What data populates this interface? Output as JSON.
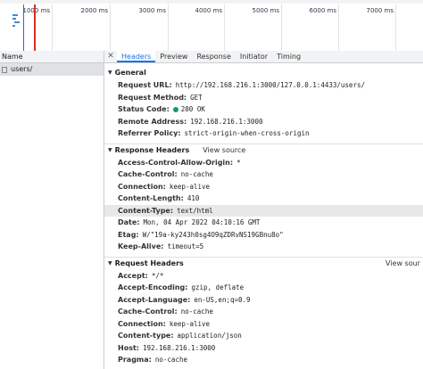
{
  "overview": {
    "ticks": [
      "1000 ms",
      "2000 ms",
      "3000 ms",
      "4000 ms",
      "5000 ms",
      "6000 ms",
      "7000 ms"
    ]
  },
  "left": {
    "column_header": "Name",
    "request_name": "users/"
  },
  "tabs": [
    "Headers",
    "Preview",
    "Response",
    "Initiator",
    "Timing"
  ],
  "general": {
    "title": "General",
    "rows": [
      {
        "key": "Request URL:",
        "value": "http://192.168.216.1:3000/127.0.0.1:4433/users/"
      },
      {
        "key": "Request Method:",
        "value": "GET"
      },
      {
        "key": "Status Code:",
        "value": "200 OK"
      },
      {
        "key": "Remote Address:",
        "value": "192.168.216.1:3000"
      },
      {
        "key": "Referrer Policy:",
        "value": "strict-origin-when-cross-origin"
      }
    ]
  },
  "response_headers": {
    "title": "Response Headers",
    "view_source": "View source",
    "rows": [
      {
        "key": "Access-Control-Allow-Origin:",
        "value": "*"
      },
      {
        "key": "Cache-Control:",
        "value": "no-cache"
      },
      {
        "key": "Connection:",
        "value": "keep-alive"
      },
      {
        "key": "Content-Length:",
        "value": "410"
      },
      {
        "key": "Content-Type:",
        "value": "text/html"
      },
      {
        "key": "Date:",
        "value": "Mon, 04 Apr 2022 04:10:16 GMT"
      },
      {
        "key": "Etag:",
        "value": "W/\"19a-ky243h0sg4O9qZDRvNS19GBnu8o\""
      },
      {
        "key": "Keep-Alive:",
        "value": "timeout=5"
      }
    ]
  },
  "request_headers": {
    "title": "Request Headers",
    "view_source": "View sour",
    "rows": [
      {
        "key": "Accept:",
        "value": "*/*"
      },
      {
        "key": "Accept-Encoding:",
        "value": "gzip, deflate"
      },
      {
        "key": "Accept-Language:",
        "value": "en-US,en;q=0.9"
      },
      {
        "key": "Cache-Control:",
        "value": "no-cache"
      },
      {
        "key": "Connection:",
        "value": "keep-alive"
      },
      {
        "key": "Content-type:",
        "value": "application/json"
      },
      {
        "key": "Host:",
        "value": "192.168.216.1:3000"
      },
      {
        "key": "Pragma:",
        "value": "no-cache"
      }
    ]
  },
  "colors": {
    "accent": "#1a73e8",
    "status_ok": "#0f9d58",
    "load_line": "#d93025",
    "dom_line": "#2962ff"
  }
}
